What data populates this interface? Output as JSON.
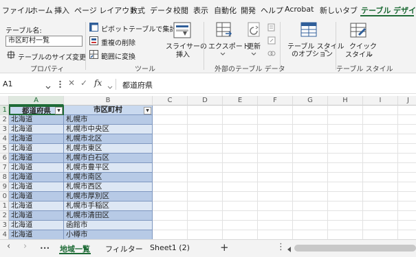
{
  "ribbon_tabs": [
    "ファイル",
    "ホーム",
    "挿入",
    "ページ レイアウト",
    "数式",
    "データ",
    "校閲",
    "表示",
    "自動化",
    "開発",
    "ヘルプ",
    "Acrobat",
    "新しいタブ",
    "テーブル デザイン"
  ],
  "properties": {
    "table_name_label": "テーブル名:",
    "table_name_value": "市区町村一覧",
    "resize_label": "テーブルのサイズ変更",
    "group_label": "プロパティ"
  },
  "tools": {
    "pivot_label": "ピボットテーブルで集計",
    "remove_dup_label": "重複の削除",
    "convert_label": "範囲に変換",
    "slicer_label_1": "スライサーの",
    "slicer_label_2": "挿入",
    "group_label": "ツール"
  },
  "external": {
    "export_label": "エクスポート",
    "refresh_label": "更新",
    "group_label": "外部のテーブル データ"
  },
  "style_options": {
    "label_1": "テーブル スタイル",
    "label_2": "のオプション",
    "chevron": "⌄"
  },
  "table_styles": {
    "quick_label_1": "クイック",
    "quick_label_2": "スタイル",
    "group_label": "テーブル スタイル"
  },
  "formula_bar": {
    "name_box": "A1",
    "cancel": "✕",
    "enter": "✓",
    "fx": "fx",
    "formula": "都道府県"
  },
  "columns": [
    "A",
    "B",
    "C",
    "D",
    "E",
    "F",
    "G",
    "H",
    "I",
    "J"
  ],
  "row_numbers": [
    "1",
    "2",
    "3",
    "4",
    "5",
    "6",
    "7",
    "8",
    "9",
    "0",
    "1",
    "2",
    "3",
    "4"
  ],
  "table": {
    "headers": [
      "都道府県",
      "市区町村"
    ],
    "rows": [
      [
        "北海道",
        "札幌市"
      ],
      [
        "北海道",
        "札幌市中央区"
      ],
      [
        "北海道",
        "札幌市北区"
      ],
      [
        "北海道",
        "札幌市東区"
      ],
      [
        "北海道",
        "札幌市白石区"
      ],
      [
        "北海道",
        "札幌市豊平区"
      ],
      [
        "北海道",
        "札幌市南区"
      ],
      [
        "北海道",
        "札幌市西区"
      ],
      [
        "北海道",
        "札幌市厚別区"
      ],
      [
        "北海道",
        "札幌市手稲区"
      ],
      [
        "北海道",
        "札幌市清田区"
      ],
      [
        "北海道",
        "函館市"
      ],
      [
        "北海道",
        "小樽市"
      ]
    ]
  },
  "sheets": {
    "prev": "‹",
    "next": "›",
    "more": "•••",
    "tabs": [
      "地域一覧",
      "フィルター",
      "Sheet1 (2)"
    ],
    "add": "+",
    "options": "⋮"
  },
  "colors": {
    "accent": "#1e6b36",
    "table_header": "#c9d9ef",
    "row_odd": "#b7cae6",
    "row_even": "#dde7f4"
  }
}
